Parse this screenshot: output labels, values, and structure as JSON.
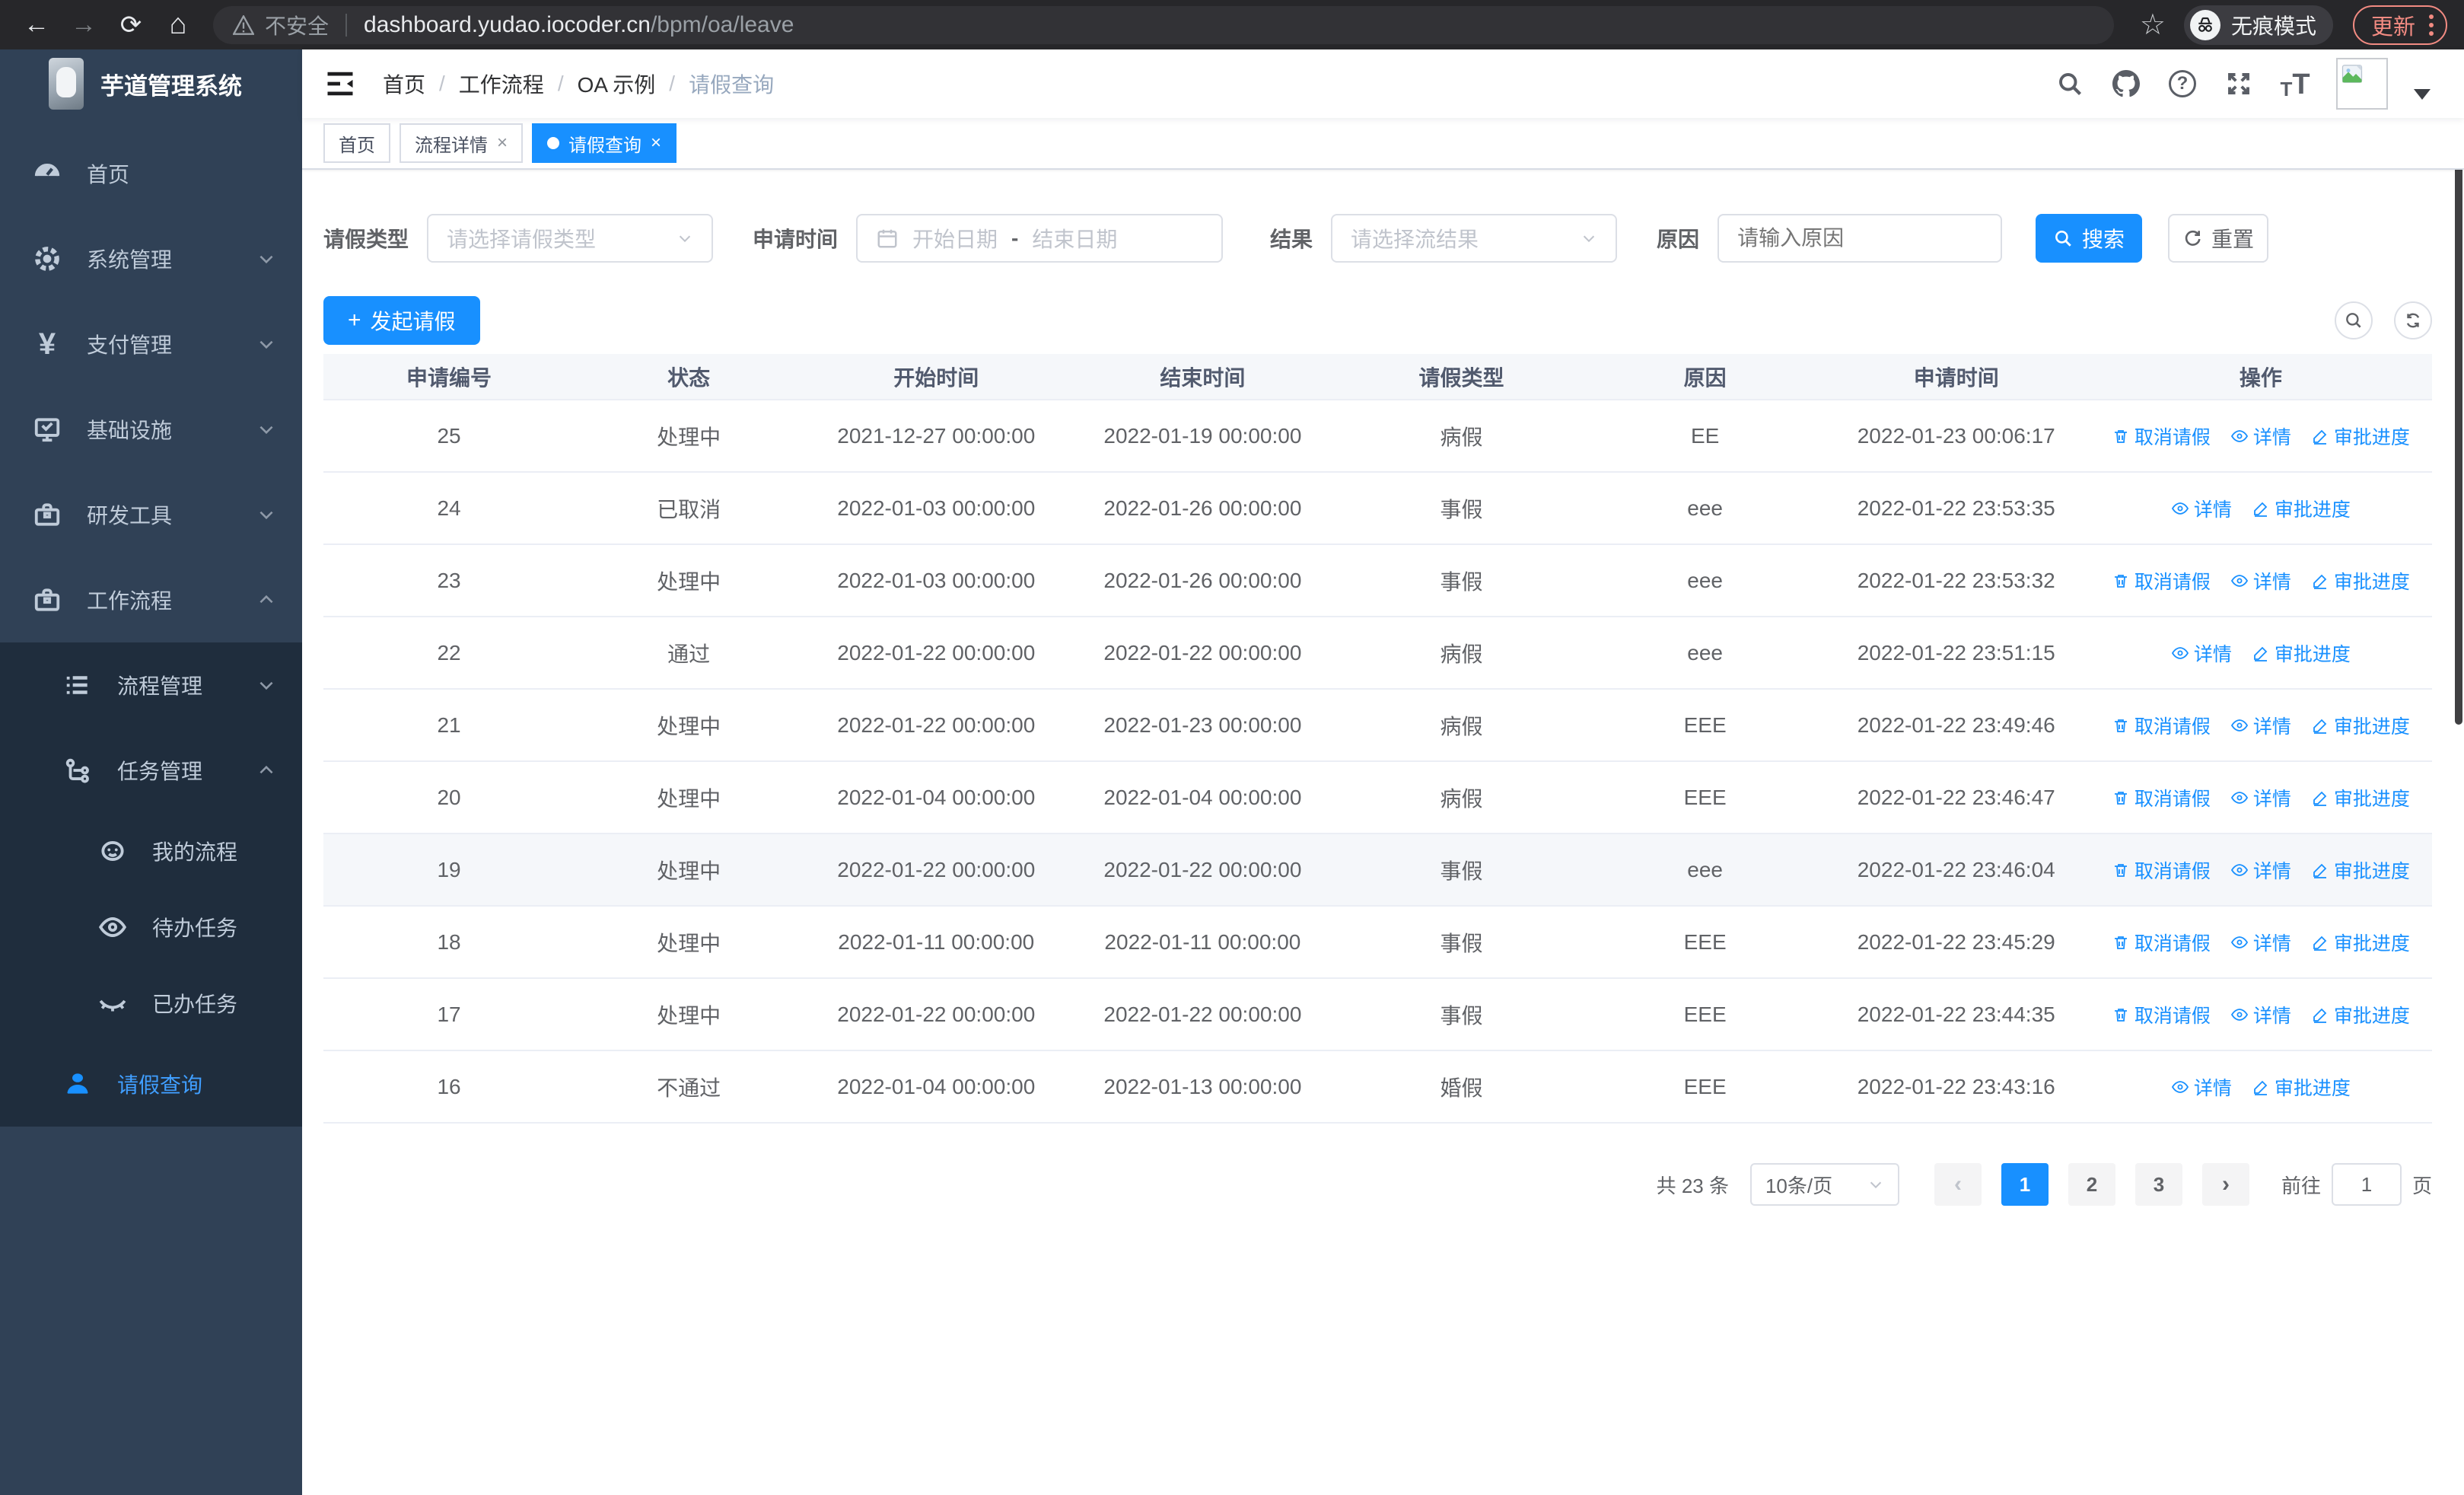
{
  "colors": {
    "primary": "#1890ff",
    "sidebar_bg": "#304156",
    "submenu_bg": "#1f2d3d",
    "sidebar_text": "#bfcbd9",
    "sidebar_active": "#409EFF",
    "update_accent": "#f28b82"
  },
  "browser": {
    "security_label": "不安全",
    "url_host": "dashboard.yudao.iocoder.cn",
    "url_path": "/bpm/oa/leave",
    "incognito_label": "无痕模式",
    "update_label": "更新"
  },
  "sidebar": {
    "logo_title": "芋道管理系统",
    "items": [
      {
        "label": "首页"
      },
      {
        "label": "系统管理"
      },
      {
        "label": "支付管理"
      },
      {
        "label": "基础设施"
      },
      {
        "label": "研发工具"
      },
      {
        "label": "工作流程"
      }
    ],
    "submenu": {
      "process_mgmt": {
        "label": "流程管理"
      },
      "task_mgmt": {
        "label": "任务管理"
      },
      "children": [
        {
          "label": "我的流程"
        },
        {
          "label": "待办任务"
        },
        {
          "label": "已办任务"
        }
      ],
      "leave_query": {
        "label": "请假查询"
      }
    },
    "yen_glyph": "¥"
  },
  "header": {
    "breadcrumb": [
      "首页",
      "工作流程",
      "OA 示例",
      "请假查询"
    ],
    "separator": "/"
  },
  "tabs": [
    {
      "label": "首页",
      "closable": false,
      "active": false
    },
    {
      "label": "流程详情",
      "closable": true,
      "active": false
    },
    {
      "label": "请假查询",
      "closable": true,
      "active": true
    }
  ],
  "filters": {
    "leave_type_label": "请假类型",
    "leave_type_placeholder": "请选择请假类型",
    "apply_time_label": "申请时间",
    "start_date_placeholder": "开始日期",
    "date_separator": "-",
    "end_date_placeholder": "结束日期",
    "result_label": "结果",
    "result_placeholder": "请选择流结果",
    "reason_label": "原因",
    "reason_placeholder": "请输入原因",
    "search_label": "搜索",
    "reset_label": "重置"
  },
  "toolbar": {
    "create_label": "发起请假"
  },
  "table": {
    "columns": [
      "申请编号",
      "状态",
      "开始时间",
      "结束时间",
      "请假类型",
      "原因",
      "申请时间",
      "操作"
    ],
    "actions": {
      "cancel": "取消请假",
      "detail": "详情",
      "progress": "审批进度"
    },
    "rows": [
      {
        "id": "25",
        "status": "处理中",
        "start": "2021-12-27 00:00:00",
        "end": "2022-01-19 00:00:00",
        "type": "病假",
        "reason": "EE",
        "apply": "2022-01-23 00:06:17",
        "actions": [
          "cancel",
          "detail",
          "progress"
        ],
        "highlight": false
      },
      {
        "id": "24",
        "status": "已取消",
        "start": "2022-01-03 00:00:00",
        "end": "2022-01-26 00:00:00",
        "type": "事假",
        "reason": "eee",
        "apply": "2022-01-22 23:53:35",
        "actions": [
          "detail",
          "progress"
        ],
        "highlight": false
      },
      {
        "id": "23",
        "status": "处理中",
        "start": "2022-01-03 00:00:00",
        "end": "2022-01-26 00:00:00",
        "type": "事假",
        "reason": "eee",
        "apply": "2022-01-22 23:53:32",
        "actions": [
          "cancel",
          "detail",
          "progress"
        ],
        "highlight": false
      },
      {
        "id": "22",
        "status": "通过",
        "start": "2022-01-22 00:00:00",
        "end": "2022-01-22 00:00:00",
        "type": "病假",
        "reason": "eee",
        "apply": "2022-01-22 23:51:15",
        "actions": [
          "detail",
          "progress"
        ],
        "highlight": false
      },
      {
        "id": "21",
        "status": "处理中",
        "start": "2022-01-22 00:00:00",
        "end": "2022-01-23 00:00:00",
        "type": "病假",
        "reason": "EEE",
        "apply": "2022-01-22 23:49:46",
        "actions": [
          "cancel",
          "detail",
          "progress"
        ],
        "highlight": false
      },
      {
        "id": "20",
        "status": "处理中",
        "start": "2022-01-04 00:00:00",
        "end": "2022-01-04 00:00:00",
        "type": "病假",
        "reason": "EEE",
        "apply": "2022-01-22 23:46:47",
        "actions": [
          "cancel",
          "detail",
          "progress"
        ],
        "highlight": false
      },
      {
        "id": "19",
        "status": "处理中",
        "start": "2022-01-22 00:00:00",
        "end": "2022-01-22 00:00:00",
        "type": "事假",
        "reason": "eee",
        "apply": "2022-01-22 23:46:04",
        "actions": [
          "cancel",
          "detail",
          "progress"
        ],
        "highlight": true
      },
      {
        "id": "18",
        "status": "处理中",
        "start": "2022-01-11 00:00:00",
        "end": "2022-01-11 00:00:00",
        "type": "事假",
        "reason": "EEE",
        "apply": "2022-01-22 23:45:29",
        "actions": [
          "cancel",
          "detail",
          "progress"
        ],
        "highlight": false
      },
      {
        "id": "17",
        "status": "处理中",
        "start": "2022-01-22 00:00:00",
        "end": "2022-01-22 00:00:00",
        "type": "事假",
        "reason": "EEE",
        "apply": "2022-01-22 23:44:35",
        "actions": [
          "cancel",
          "detail",
          "progress"
        ],
        "highlight": false
      },
      {
        "id": "16",
        "status": "不通过",
        "start": "2022-01-04 00:00:00",
        "end": "2022-01-13 00:00:00",
        "type": "婚假",
        "reason": "EEE",
        "apply": "2022-01-22 23:43:16",
        "actions": [
          "detail",
          "progress"
        ],
        "highlight": false
      }
    ]
  },
  "pagination": {
    "total_label": "共 23 条",
    "page_size": "10条/页",
    "prev_glyph": "‹",
    "next_glyph": "›",
    "pages": [
      "1",
      "2",
      "3"
    ],
    "active_page": "1",
    "goto_label": "前往",
    "goto_value": "1",
    "page_suffix": "页"
  }
}
